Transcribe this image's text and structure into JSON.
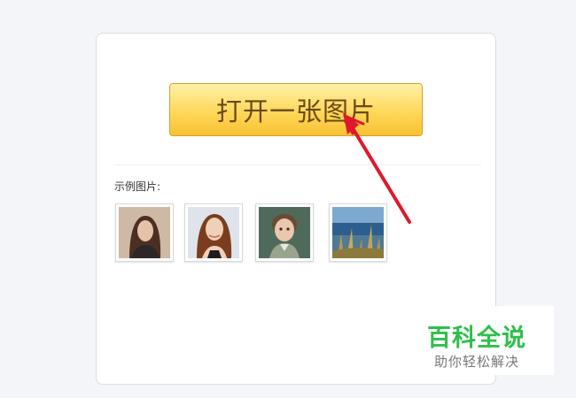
{
  "main": {
    "open_button_label": "打开一张图片",
    "samples_label": "示例图片:"
  },
  "samples": [
    {
      "icon": "portrait-girl-brown-hair"
    },
    {
      "icon": "portrait-woman-smiling"
    },
    {
      "icon": "portrait-child"
    },
    {
      "icon": "landscape-grass-sea"
    }
  ],
  "watermark": {
    "title": "百科全说",
    "subtitle": "助你轻松解决"
  },
  "colors": {
    "button_gradient_top": "#fff1a8",
    "button_gradient_bottom": "#f8c233",
    "button_text": "#6b4a12",
    "arrow": "#e0182c",
    "watermark_title": "#2fbf4b"
  }
}
